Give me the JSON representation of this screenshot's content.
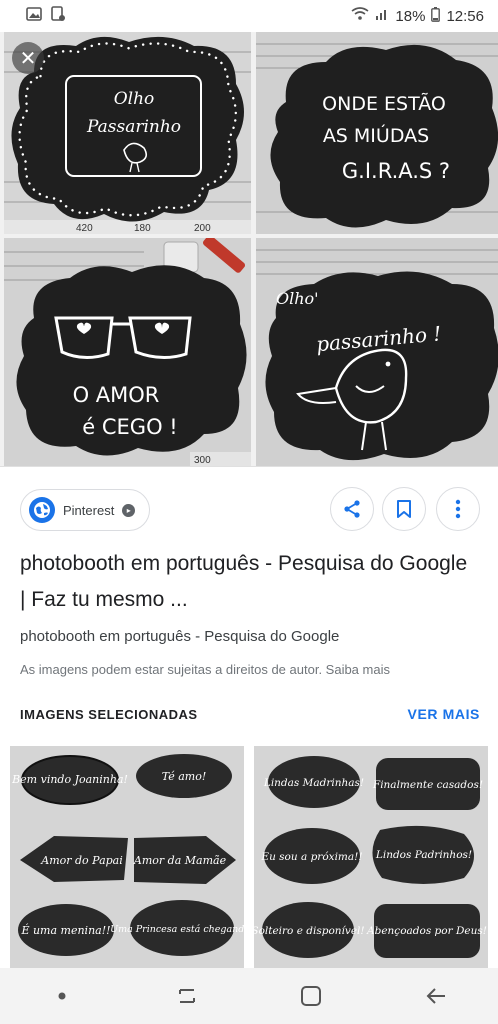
{
  "status_bar": {
    "battery": "18%",
    "time": "12:56"
  },
  "viewer": {
    "close_label": "✕",
    "photos": [
      {
        "name": "olho-passarinho-frame",
        "lines": [
          "Olho",
          "Passarinho"
        ],
        "ruler": [
          "420",
          "180",
          "200"
        ]
      },
      {
        "name": "onde-estao-miudas-giras",
        "lines": [
          "ONDE ESTÃO",
          "AS MIÚDAS",
          "G.I.R.A.S ?"
        ]
      },
      {
        "name": "o-amor-e-cego",
        "lines": [
          "O AMOR",
          "é CEGO !"
        ],
        "ruler": [
          "300"
        ]
      },
      {
        "name": "olho-passarinho-bird",
        "lines": [
          "Olho'",
          "passarinho !"
        ]
      }
    ]
  },
  "source": {
    "label": "Pinterest"
  },
  "result": {
    "title": "photobooth em português - Pesquisa do Google | Faz tu mesmo ...",
    "site": "photobooth em português - Pesquisa do Google",
    "note": "As imagens podem estar sujeitas a direitos de autor. Saiba mais"
  },
  "selected": {
    "title": "IMAGENS SELECIONADAS",
    "more": "VER MAIS",
    "left_labels": [
      "Bem vindo Joaninha!",
      "Té amo!",
      "Amor do Papai",
      "Amor da Mamãe",
      "É uma menina!!",
      "Uma Princesa está chegando!"
    ],
    "right_labels": [
      "Lindas Madrinhas!",
      "Finalmente casados!",
      "Eu sou a próxima!!",
      "Lindos Padrinhos!",
      "Solteiro e disponível!",
      "Abençoados por Deus!"
    ]
  },
  "colors": {
    "accent": "#1a73e8",
    "chalkboard": "#1f1f1f"
  }
}
